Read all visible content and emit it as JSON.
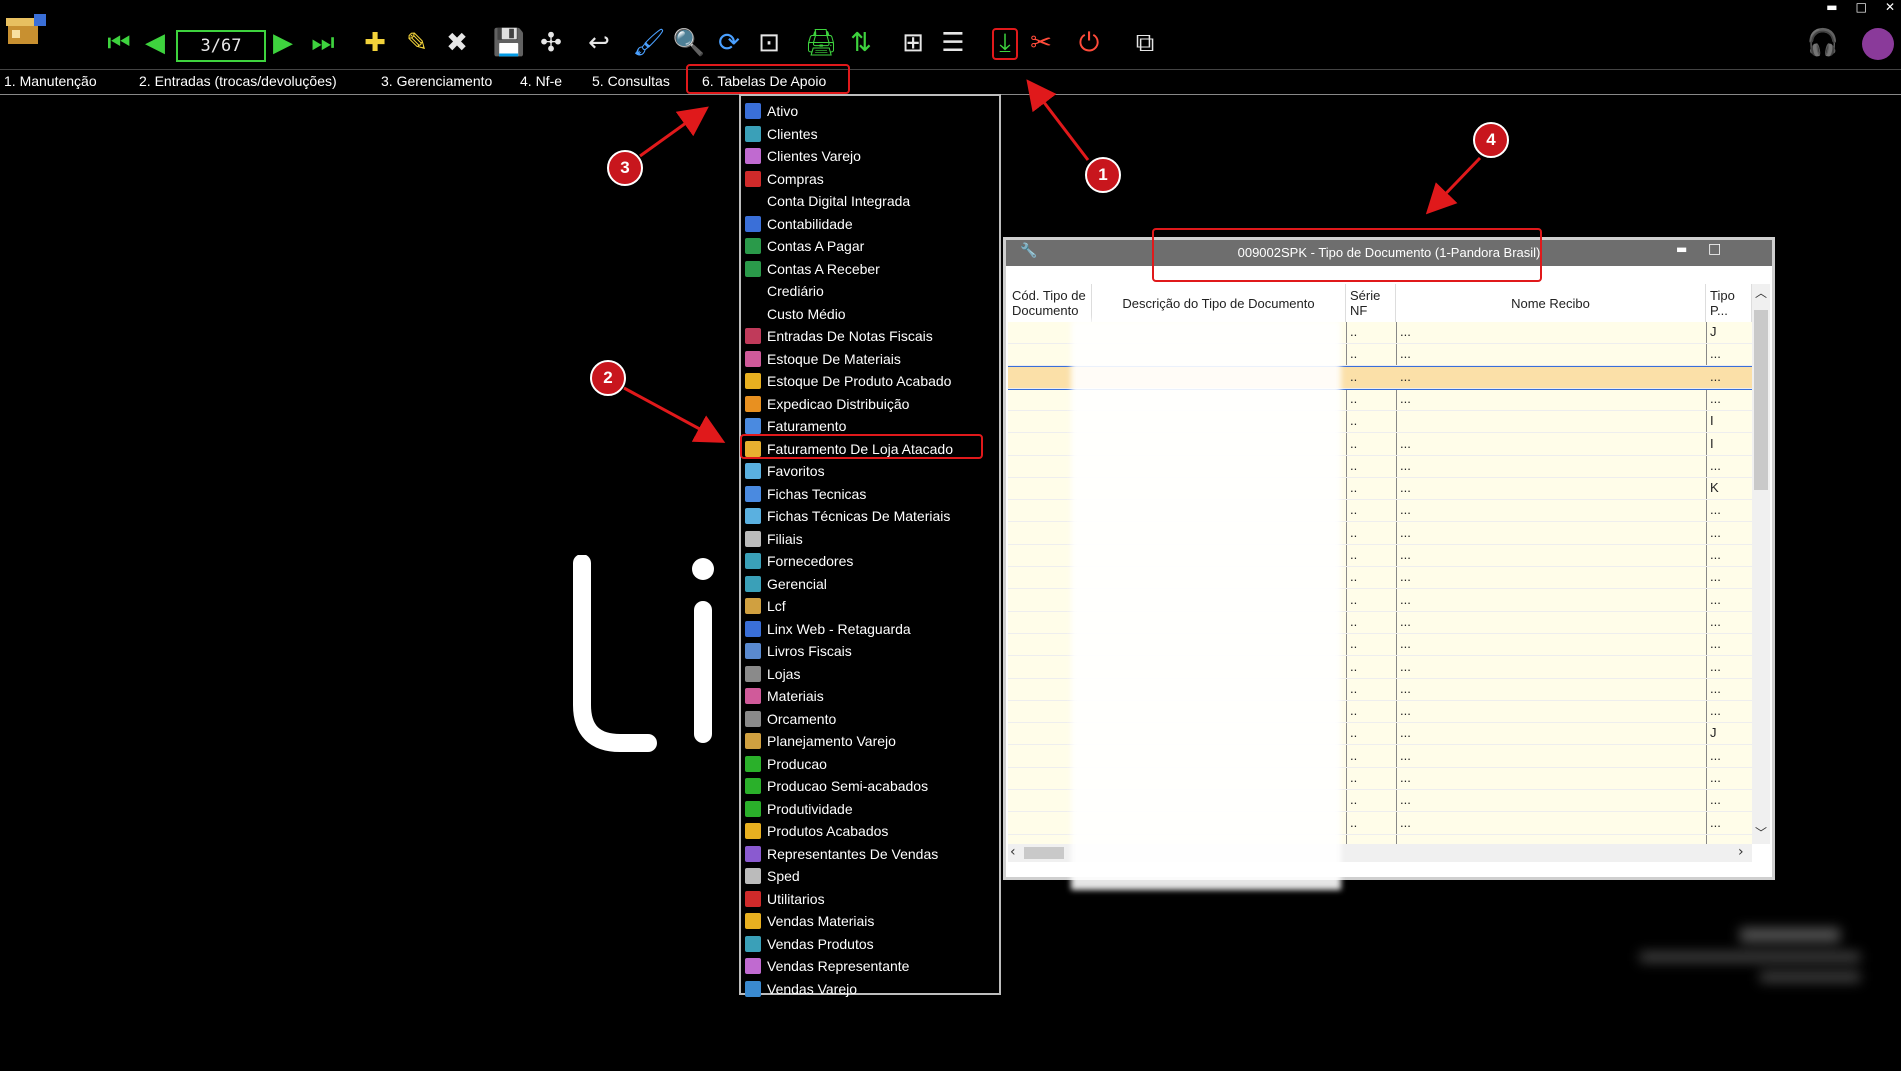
{
  "toolbar": {
    "page_counter": "3/67",
    "icons": [
      "first-record-icon",
      "previous-record-icon",
      "next-record-icon",
      "last-record-icon",
      "add-icon",
      "edit-icon",
      "delete-icon",
      "save-icon",
      "extra-icon",
      "undo-icon",
      "clean-icon",
      "search-icon",
      "refresh-icon",
      "zoom-window-icon",
      "print-icon",
      "sort-icon",
      "new-document-icon",
      "document-list-icon",
      "export-icon",
      "tools-icon",
      "power-icon",
      "multi-window-icon"
    ],
    "right_icons": [
      "support-headset-icon",
      "user-avatar-icon"
    ]
  },
  "menubar": {
    "items": [
      "1. Manutenção",
      "2. Entradas (trocas/devoluções)",
      "3. Gerenciamento",
      "4. Nf-e",
      "5. Consultas",
      "6. Tabelas De Apoio"
    ]
  },
  "dropdown": {
    "items": [
      "Ativo",
      "Clientes",
      "Clientes Varejo",
      "Compras",
      "Conta Digital Integrada",
      "Contabilidade",
      "Contas A Pagar",
      "Contas A Receber",
      "Crediário",
      "Custo Médio",
      "Entradas De Notas Fiscais",
      "Estoque De Materiais",
      "Estoque De Produto Acabado",
      "Expedicao Distribuição",
      "Faturamento",
      "Faturamento De Loja Atacado",
      "Favoritos",
      "Fichas Tecnicas",
      "Fichas Técnicas De Materiais",
      "Filiais",
      "Fornecedores",
      "Gerencial",
      "Lcf",
      "Linx Web - Retaguarda",
      "Livros Fiscais",
      "Lojas",
      "Materiais",
      "Orcamento",
      "Planejamento Varejo",
      "Producao",
      "Producao Semi-acabados",
      "Produtividade",
      "Produtos Acabados",
      "Representantes De Vendas",
      "Sped",
      "Utilitarios",
      "Vendas Materiais",
      "Vendas Produtos",
      "Vendas Representante",
      "Vendas Varejo"
    ],
    "icon_colors": [
      "#3a6fd8",
      "#3aa0b8",
      "#c06ad0",
      "#d02a2a",
      "#000000",
      "#3a6fd8",
      "#2a9a4a",
      "#2a9a4a",
      "#000000",
      "#000000",
      "#c03a5a",
      "#d05a9a",
      "#e8b020",
      "#e89020",
      "#4a8ae0",
      "#e8b030",
      "#5ab0e0",
      "#4a8ae0",
      "#5ab0e0",
      "#bbbbbb",
      "#3aa0b8",
      "#3aa0b8",
      "#d0a040",
      "#3a6fd8",
      "#5a8ad0",
      "#8a8a8a",
      "#d05a9a",
      "#8a8a8a",
      "#d0a040",
      "#2ab02a",
      "#2ab02a",
      "#2ab02a",
      "#e8b020",
      "#8a5ad0",
      "#bbbbbb",
      "#d02a2a",
      "#e8b020",
      "#3aa0b8",
      "#c06ad0",
      "#3a8ad0"
    ]
  },
  "annotations": {
    "labels": [
      "1",
      "2",
      "3",
      "4"
    ]
  },
  "background_logo": "Li",
  "child_window": {
    "title": "009002SPK - Tipo de Documento (1-Pandora Brasil)",
    "columns": [
      "Cód. Tipo de Documento",
      "Descrição do Tipo de Documento",
      "Série NF",
      "Nome Recibo",
      "Tipo P..."
    ],
    "rows": [
      {
        "serie": "..",
        "recibo": "...",
        "tipo": "J"
      },
      {
        "serie": "..",
        "recibo": "...",
        "tipo": "..."
      },
      {
        "serie": "..",
        "recibo": "...",
        "tipo": "..."
      },
      {
        "serie": "..",
        "recibo": "...",
        "tipo": "..."
      },
      {
        "serie": "..",
        "recibo": "",
        "tipo": "I"
      },
      {
        "serie": "..",
        "recibo": "...",
        "tipo": "I"
      },
      {
        "serie": "..",
        "recibo": "...",
        "tipo": "..."
      },
      {
        "serie": "..",
        "recibo": "...",
        "tipo": "K"
      },
      {
        "serie": "..",
        "recibo": "...",
        "tipo": "..."
      },
      {
        "serie": "..",
        "recibo": "...",
        "tipo": "..."
      },
      {
        "serie": "..",
        "recibo": "...",
        "tipo": "..."
      },
      {
        "serie": "..",
        "recibo": "...",
        "tipo": "..."
      },
      {
        "serie": "..",
        "recibo": "...",
        "tipo": "..."
      },
      {
        "serie": "..",
        "recibo": "...",
        "tipo": "..."
      },
      {
        "serie": "..",
        "recibo": "...",
        "tipo": "..."
      },
      {
        "serie": "..",
        "recibo": "...",
        "tipo": "..."
      },
      {
        "serie": "..",
        "recibo": "...",
        "tipo": "..."
      },
      {
        "serie": "..",
        "recibo": "...",
        "tipo": "..."
      },
      {
        "serie": "..",
        "recibo": "...",
        "tipo": "J"
      },
      {
        "serie": "..",
        "recibo": "...",
        "tipo": "..."
      },
      {
        "serie": "..",
        "recibo": "...",
        "tipo": "..."
      },
      {
        "serie": "..",
        "recibo": "...",
        "tipo": "..."
      },
      {
        "serie": "..",
        "recibo": "...",
        "tipo": "..."
      }
    ]
  },
  "glyphs": {
    "first": "⏮",
    "prev": "◀",
    "next": "▶",
    "last": "⏭",
    "add": "✚",
    "edit": "✎",
    "delete": "✖",
    "save": "💾",
    "extra": "✣",
    "undo": "↩",
    "clean": "🖌",
    "search": "🔍",
    "refresh": "⟳",
    "zoom": "⊡",
    "print": "🖨",
    "sort": "⇅",
    "newdoc": "⊞",
    "doclist": "☰",
    "export": "⤓",
    "tools": "✂",
    "power": "⏻",
    "multiwin": "⧉",
    "headset": "🎧",
    "minimize": "▬",
    "maximize": "□",
    "close": "✕",
    "scroll_up": "︿",
    "scroll_down": "﹀",
    "scroll_left": "‹",
    "scroll_right": "›",
    "wrench": "🔧"
  }
}
